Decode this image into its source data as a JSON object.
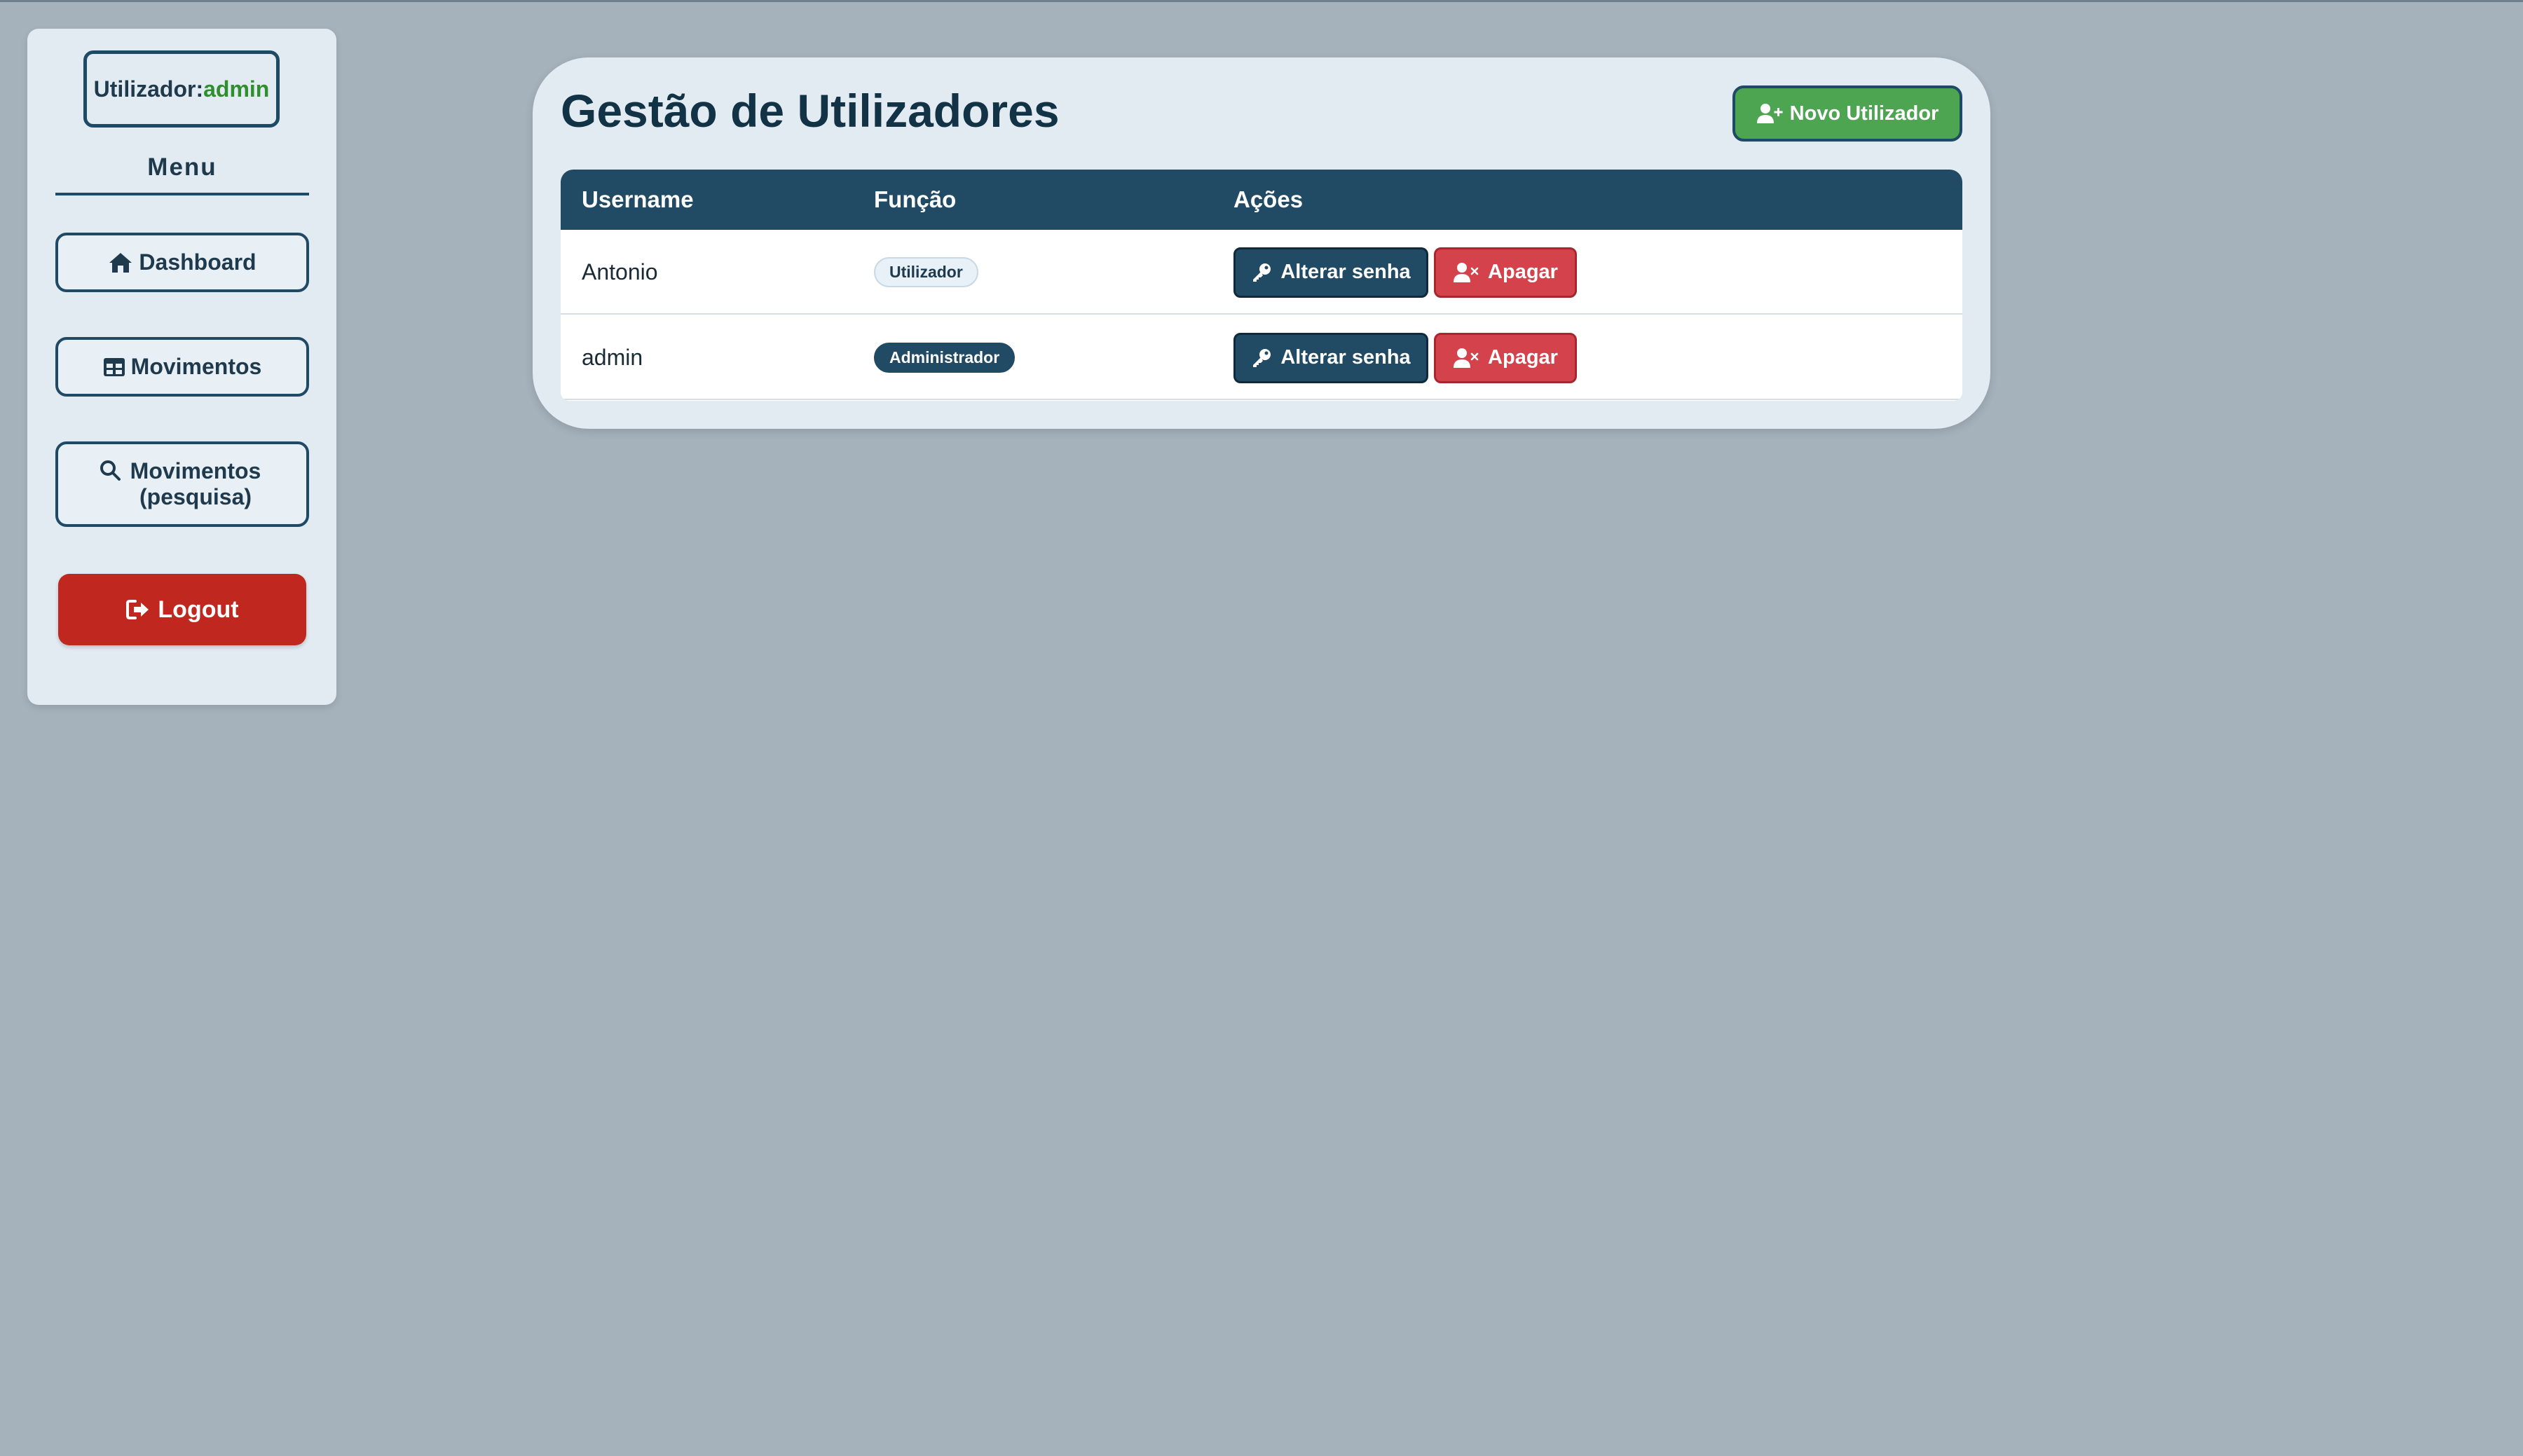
{
  "sidebar": {
    "user_label": "Utilizador:",
    "user_name": "admin",
    "menu_title": "Menu",
    "items": [
      {
        "label": "Dashboard",
        "icon": "home-icon"
      },
      {
        "label": "Movimentos",
        "icon": "table-icon"
      },
      {
        "label": "Movimentos (pesquisa)",
        "icon": "search-icon"
      }
    ],
    "logout_label": "Logout"
  },
  "main": {
    "title": "Gestão de Utilizadores",
    "new_user_label": "Novo Utilizador",
    "table": {
      "headers": [
        "Username",
        "Função",
        "Ações"
      ],
      "rows": [
        {
          "username": "Antonio",
          "role": "Utilizador",
          "change_password": "Alterar senha",
          "delete": "Apagar"
        },
        {
          "username": "admin",
          "role": "Administrador",
          "change_password": "Alterar senha",
          "delete": "Apagar"
        }
      ]
    }
  },
  "colors": {
    "background": "#a5b1bb",
    "primary": "#214a64",
    "success": "#4ea551",
    "danger": "#d4424b",
    "logout": "#c0271f"
  }
}
